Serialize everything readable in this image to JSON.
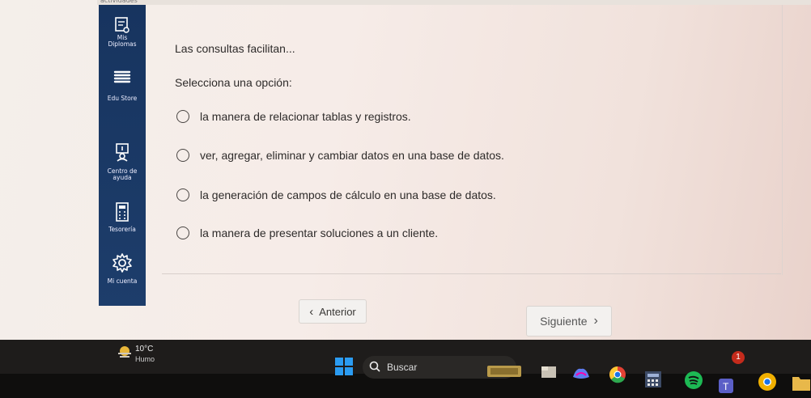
{
  "top_strip": {
    "text": "actividades"
  },
  "sidebar": {
    "items": [
      {
        "label_line1": "Mis",
        "label_line2": "Diplomas",
        "icon": "diploma-icon"
      },
      {
        "label_line1": "",
        "label_line2": "Edu Store",
        "icon": "book-stack-icon"
      },
      {
        "label_line1": "Centro de",
        "label_line2": "ayuda",
        "icon": "help-desk-icon"
      },
      {
        "label_line1": "",
        "label_line2": "Tesorería",
        "icon": "calculator-icon"
      },
      {
        "label_line1": "",
        "label_line2": "Mi cuenta",
        "icon": "gear-icon"
      }
    ]
  },
  "quiz": {
    "question": "Las consultas facilitan...",
    "instruction": "Selecciona una opción:",
    "options": [
      "la manera de relacionar tablas y registros.",
      "ver, agregar, eliminar y cambiar datos en una base de datos.",
      "la generación de campos de cálculo en una base de datos.",
      "la manera de presentar soluciones a un cliente."
    ]
  },
  "nav": {
    "prev_label": "Anterior",
    "next_label": "Siguiente"
  },
  "taskbar": {
    "weather_temp": "10°C",
    "weather_desc": "Humo",
    "search_label": "Buscar",
    "notification_badge": "1",
    "apps": [
      "file-explorer-icon",
      "copilot-icon",
      "chrome-icon",
      "calculator-app-icon",
      "spotify-icon",
      "teams-icon",
      "chrome-alt-icon",
      "folder-icon"
    ]
  },
  "colors": {
    "sidebar_bg": "#1d3d6b",
    "accent_windows": "#2b9cf2",
    "spotify_green": "#1db954"
  }
}
